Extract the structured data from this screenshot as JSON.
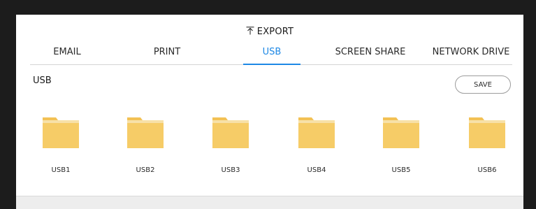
{
  "header": {
    "title": "EXPORT",
    "icon": "export-upload-icon"
  },
  "tabs": [
    {
      "label": "EMAIL",
      "active": false
    },
    {
      "label": "PRINT",
      "active": false
    },
    {
      "label": "USB",
      "active": true
    },
    {
      "label": "SCREEN SHARE",
      "active": false
    },
    {
      "label": "NETWORK DRIVE",
      "active": false
    }
  ],
  "section": {
    "title": "USB",
    "save_label": "SAVE"
  },
  "folders": [
    {
      "label": "USB1",
      "icon": "folder-icon"
    },
    {
      "label": "USB2",
      "icon": "folder-icon"
    },
    {
      "label": "USB3",
      "icon": "folder-icon"
    },
    {
      "label": "USB4",
      "icon": "folder-icon"
    },
    {
      "label": "USB5",
      "icon": "folder-icon"
    },
    {
      "label": "USB6",
      "icon": "folder-icon"
    }
  ],
  "colors": {
    "accent": "#1e88e5",
    "folder": "#f6cc67",
    "folder_tab": "#f3c154"
  }
}
